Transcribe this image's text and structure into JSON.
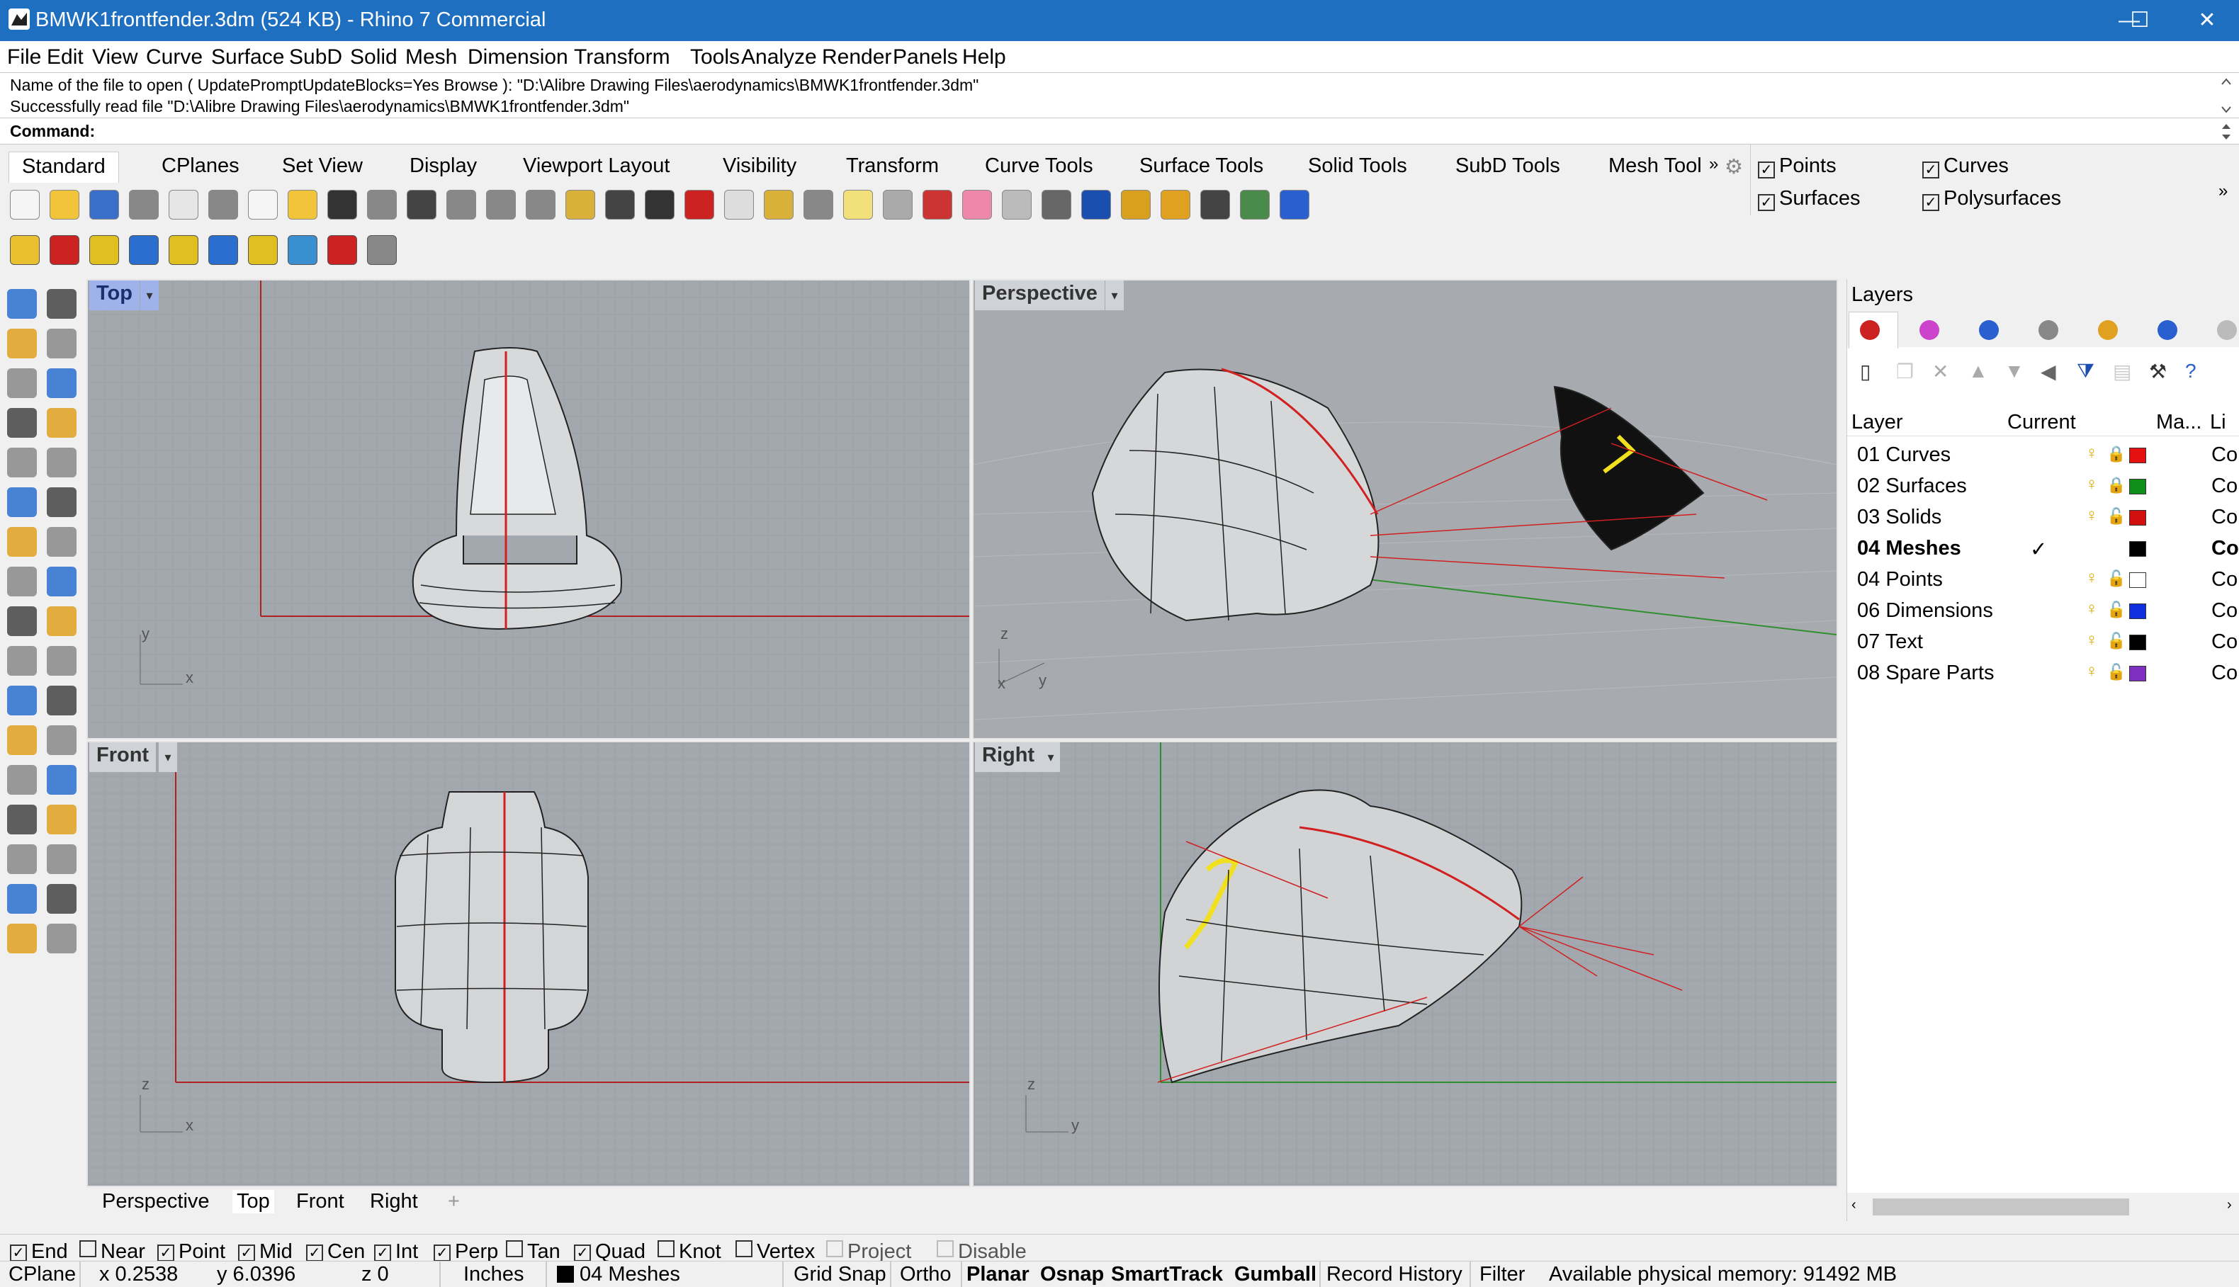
{
  "window": {
    "title": "BMWK1frontfender.3dm (524 KB) - Rhino 7 Commercial",
    "minimize": "—",
    "maximize": "☐",
    "close": "✕"
  },
  "menu": [
    "File",
    "Edit",
    "View",
    "Curve",
    "Surface",
    "SubD",
    "Solid",
    "Mesh",
    "Dimension",
    "Transform",
    "Tools",
    "Analyze",
    "Render",
    "Panels",
    "Help"
  ],
  "command": {
    "history": [
      "Name of the file to open ( UpdatePromptUpdateBlocks=Yes  Browse ): \"D:\\Alibre Drawing Files\\aerodynamics\\BMWK1frontfender.3dm\"",
      "Successfully read file \"D:\\Alibre Drawing Files\\aerodynamics\\BMWK1frontfender.3dm\""
    ],
    "prompt": "Command:"
  },
  "toolbar_tabs": [
    "Standard",
    "CPlanes",
    "Set View",
    "Display",
    "Viewport Layout",
    "Visibility",
    "Transform",
    "Curve Tools",
    "Surface Tools",
    "Solid Tools",
    "SubD Tools",
    "Mesh Tool"
  ],
  "toolbar_overflow": "»",
  "select_filter": {
    "items": [
      {
        "label": "Points",
        "checked": true
      },
      {
        "label": "Curves",
        "checked": true
      },
      {
        "label": "Surfaces",
        "checked": true
      },
      {
        "label": "Polysurfaces",
        "checked": true
      }
    ],
    "more": "»"
  },
  "viewports": {
    "top": {
      "label": "Top",
      "active": true,
      "axis_a": "y",
      "axis_b": "x"
    },
    "perspective": {
      "label": "Perspective",
      "active": false,
      "axis_a": "z",
      "axis_b": "x",
      "axis_c": "y"
    },
    "front": {
      "label": "Front",
      "active": false,
      "axis_a": "z",
      "axis_b": "x"
    },
    "right": {
      "label": "Right",
      "active": false,
      "axis_a": "z",
      "axis_b": "y"
    },
    "dropdown_glyph": "▾"
  },
  "viewport_tabs": {
    "items": [
      "Perspective",
      "Top",
      "Front",
      "Right"
    ],
    "active": "Top",
    "add": "+"
  },
  "layers_panel": {
    "title": "Layers",
    "columns": {
      "layer": "Layer",
      "current": "Current",
      "material": "Ma...",
      "linetype": "Li"
    },
    "rows": [
      {
        "name": "01 Curves",
        "current": false,
        "locked": true,
        "color": "#e51010",
        "linetype": "Co"
      },
      {
        "name": "02 Surfaces",
        "current": false,
        "locked": true,
        "color": "#10901a",
        "linetype": "Co"
      },
      {
        "name": "03 Solids",
        "current": false,
        "locked": false,
        "color": "#d21010",
        "linetype": "Co"
      },
      {
        "name": "04 Meshes",
        "current": true,
        "locked": false,
        "color": "#000000",
        "linetype": "Co"
      },
      {
        "name": "04 Points",
        "current": false,
        "locked": false,
        "color": "#ffffff",
        "linetype": "Co"
      },
      {
        "name": "06 Dimensions",
        "current": false,
        "locked": false,
        "color": "#1030e0",
        "linetype": "Co"
      },
      {
        "name": "07 Text",
        "current": false,
        "locked": false,
        "color": "#000000",
        "linetype": "Co"
      },
      {
        "name": "08 Spare Parts",
        "current": false,
        "locked": false,
        "color": "#8030c0",
        "linetype": "Co"
      }
    ],
    "current_mark": "✓"
  },
  "osnaps": [
    {
      "label": "End",
      "checked": true
    },
    {
      "label": "Near",
      "checked": false
    },
    {
      "label": "Point",
      "checked": true
    },
    {
      "label": "Mid",
      "checked": true
    },
    {
      "label": "Cen",
      "checked": true
    },
    {
      "label": "Int",
      "checked": true
    },
    {
      "label": "Perp",
      "checked": true
    },
    {
      "label": "Tan",
      "checked": false
    },
    {
      "label": "Quad",
      "checked": true
    },
    {
      "label": "Knot",
      "checked": false
    },
    {
      "label": "Vertex",
      "checked": false
    },
    {
      "label": "Project",
      "checked": false,
      "disabled": true
    },
    {
      "label": "Disable",
      "checked": false,
      "disabled": true
    }
  ],
  "status": {
    "cplane": "CPlane",
    "x": "x 0.2538",
    "y": "y 6.0396",
    "z": "z 0",
    "units": "Inches",
    "layer": "04 Meshes",
    "grid_snap": "Grid Snap",
    "ortho": "Ortho",
    "planar": "Planar",
    "osnap": "Osnap",
    "smarttrack": "SmartTrack",
    "gumball": "Gumball",
    "record_history": "Record History",
    "filter": "Filter",
    "memory": "Available physical memory: 91492 MB"
  },
  "colors": {
    "titlebar": "#1f6fc1",
    "viewport_bg": "#a3a8ae",
    "grid_line": "#9aa0a6",
    "axis_x": "#b02020",
    "axis_y": "#2f8f2f",
    "active_viewport_label": "#9fb3ea"
  }
}
